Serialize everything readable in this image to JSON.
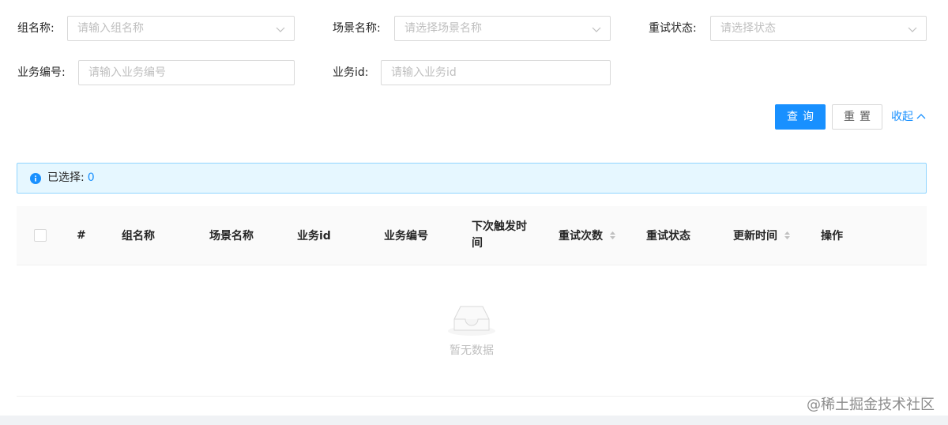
{
  "search_form": {
    "group_name_label": "组名称:",
    "group_name_placeholder": "请输入组名称",
    "scene_name_label": "场景名称:",
    "scene_name_placeholder": "请选择场景名称",
    "retry_status_label": "重试状态:",
    "retry_status_placeholder": "请选择状态",
    "biz_no_label": "业务编号:",
    "biz_no_placeholder": "请输入业务编号",
    "biz_id_label": "业务id:",
    "biz_id_placeholder": "请输入业务id"
  },
  "actions": {
    "query_label": "查询",
    "reset_label": "重置",
    "collapse_label": "收起"
  },
  "alert": {
    "selected_label": "已选择:",
    "selected_count": "0"
  },
  "table": {
    "columns": [
      {
        "label": "#"
      },
      {
        "label": "组名称"
      },
      {
        "label": "场景名称"
      },
      {
        "label": "业务id"
      },
      {
        "label": "业务编号"
      },
      {
        "label": "下次触发时间"
      },
      {
        "label": "重试次数"
      },
      {
        "label": "重试状态"
      },
      {
        "label": "更新时间"
      },
      {
        "label": "操作"
      }
    ],
    "empty_text": "暂无数据"
  },
  "watermark": "@稀土掘金技术社区",
  "colors": {
    "primary": "#1890ff",
    "alert_bg": "#e6f7ff",
    "alert_border": "#91d5ff",
    "placeholder": "#bfbfbf"
  }
}
